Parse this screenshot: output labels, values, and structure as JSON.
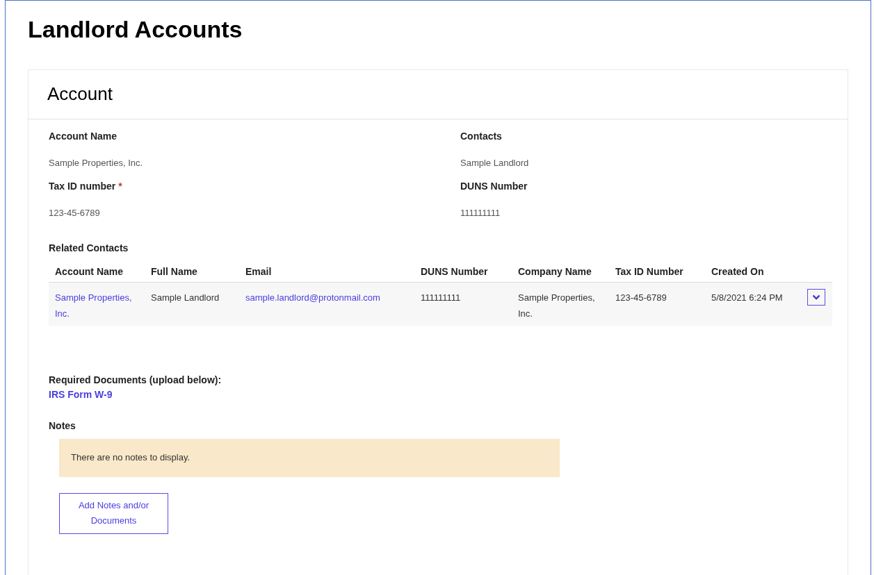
{
  "page_title": "Landlord Accounts",
  "card": {
    "title": "Account",
    "fields": [
      {
        "label": "Account Name",
        "value": "Sample Properties, Inc."
      },
      {
        "label": "Contacts",
        "value": "Sample Landlord"
      },
      {
        "label": "Tax ID number",
        "value": "123-45-6789",
        "required_mark": "*"
      },
      {
        "label": "DUNS Number",
        "value": "111111111"
      }
    ],
    "related_contacts": {
      "title": "Related Contacts",
      "columns": [
        "Account Name",
        "Full Name",
        "Email",
        "DUNS Number",
        "Company Name",
        "Tax ID Number",
        "Created On"
      ],
      "rows": [
        {
          "cells": [
            {
              "kind": "link",
              "text": "Sample Properties, Inc."
            },
            {
              "kind": "text",
              "text": "Sample Landlord"
            },
            {
              "kind": "link",
              "text": "sample.landlord@protonmail.com"
            },
            {
              "kind": "text",
              "text": "111111111"
            },
            {
              "kind": "text",
              "text": "Sample Properties, Inc."
            },
            {
              "kind": "text",
              "text": "123-45-6789"
            },
            {
              "kind": "text",
              "text": "5/8/2021 6:24 PM"
            }
          ]
        }
      ]
    },
    "required_documents": {
      "title": "Required Documents (upload below):",
      "links": [
        "IRS Form W-9"
      ]
    },
    "notes": {
      "title": "Notes",
      "empty_message": "There are no notes to display.",
      "button": "Add Notes and/or Documents"
    }
  }
}
